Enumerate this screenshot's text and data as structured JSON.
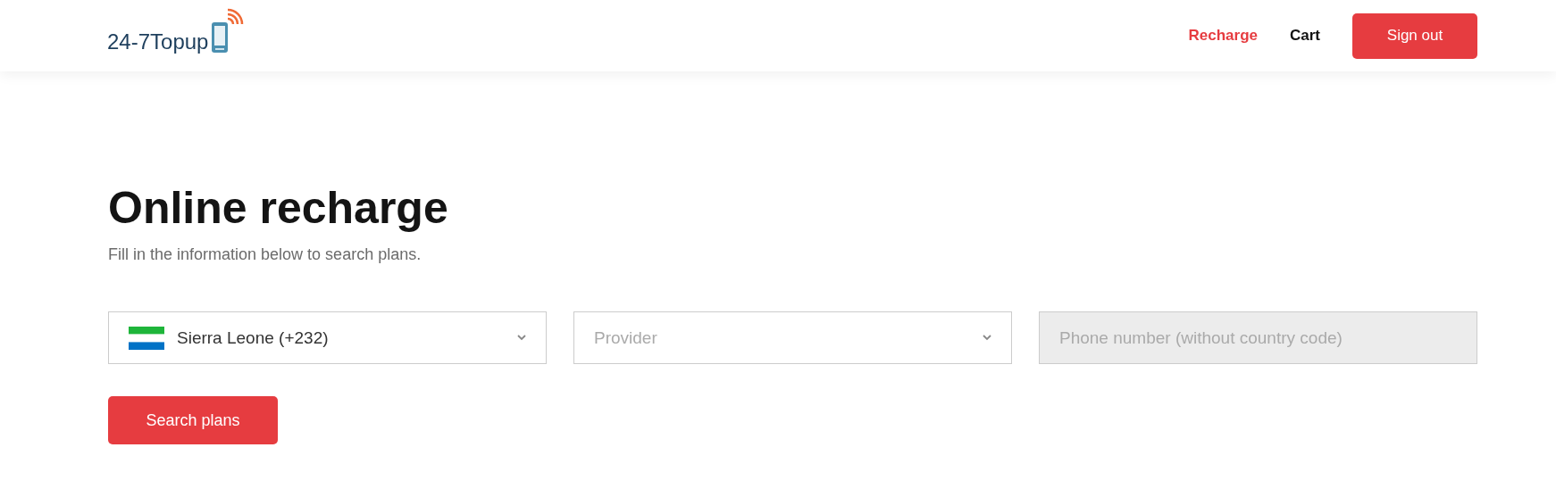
{
  "header": {
    "logo_text": "24-7Topup",
    "nav": [
      {
        "label": "Recharge",
        "selected": true
      },
      {
        "label": "Cart",
        "selected": false
      }
    ],
    "sign_out": "Sign out"
  },
  "title": "Online recharge",
  "subtitle": "Fill in the information below to search plans.",
  "fields": [
    {
      "kind": "select",
      "value": "Sierra Leone (+232)",
      "flag": true
    },
    {
      "kind": "select",
      "placeholder": "Provider"
    },
    {
      "kind": "input",
      "placeholder": "Phone number (without country code)",
      "disabled": true
    }
  ],
  "search_button": "Search plans"
}
